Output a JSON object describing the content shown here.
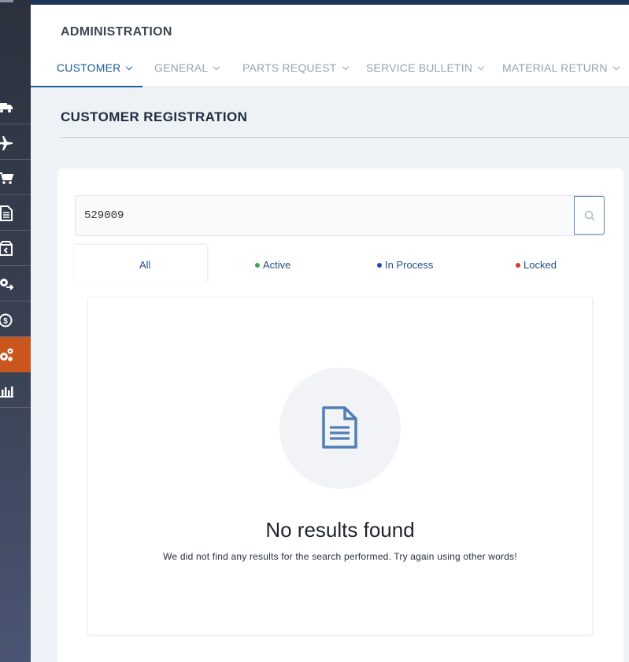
{
  "header": {
    "title": "ADMINISTRATION",
    "nav": [
      {
        "label": "CUSTOMER",
        "active": true
      },
      {
        "label": "GENERAL",
        "active": false
      },
      {
        "label": "PARTS REQUEST",
        "active": false
      },
      {
        "label": "SERVICE BULLETIN",
        "active": false
      },
      {
        "label": "MATERIAL RETURN",
        "active": false
      }
    ]
  },
  "sidebar": {
    "items": [
      {
        "icon": "truck-icon"
      },
      {
        "icon": "airplane-icon"
      },
      {
        "icon": "cart-icon"
      },
      {
        "icon": "document-icon"
      },
      {
        "icon": "package-return-icon"
      },
      {
        "icon": "gear-exchange-icon"
      },
      {
        "icon": "money-cycle-icon"
      },
      {
        "icon": "gears-icon",
        "active": true
      },
      {
        "icon": "bar-chart-icon"
      }
    ]
  },
  "page": {
    "section_title": "CUSTOMER REGISTRATION"
  },
  "search": {
    "value": "529009",
    "placeholder": ""
  },
  "filters": {
    "all": "All",
    "active": "Active",
    "in_process": "In Process",
    "locked": "Locked"
  },
  "colors": {
    "active_dot": "#3fa55a",
    "in_process_dot": "#1f4aa8",
    "locked_dot": "#d7362c",
    "accent": "#1e5d96",
    "sidebar_active": "#c8561d"
  },
  "empty_state": {
    "icon": "document-icon",
    "title": "No results found",
    "message": "We did not find any results for the search performed. Try again using other words!"
  }
}
